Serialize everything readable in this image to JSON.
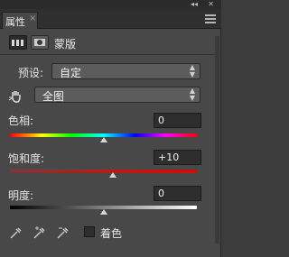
{
  "window": {
    "collapse_glyph": "◂◂",
    "close_glyph": "✕"
  },
  "tab": {
    "title": "属性",
    "close_glyph": "×"
  },
  "mode": {
    "adjustment_icon": "adjustment-icon",
    "mask_icon": "mask-icon",
    "label": "蒙版"
  },
  "preset": {
    "label": "预设:",
    "value": "自定",
    "arrow": "◆"
  },
  "channel": {
    "value": "全图",
    "arrow": "◆"
  },
  "hue": {
    "label": "色相:",
    "value": "0",
    "level": 0.5
  },
  "saturation": {
    "label": "饱和度:",
    "value": "+10",
    "level": 0.55
  },
  "lightness": {
    "label": "明度:",
    "value": "0",
    "level": 0.5
  },
  "bottom": {
    "eyedroppers": [
      "eyedropper-icon",
      "eyedropper-add-icon",
      "eyedropper-subtract-icon"
    ],
    "colorize_label": "着色",
    "colorize_checked": false
  }
}
